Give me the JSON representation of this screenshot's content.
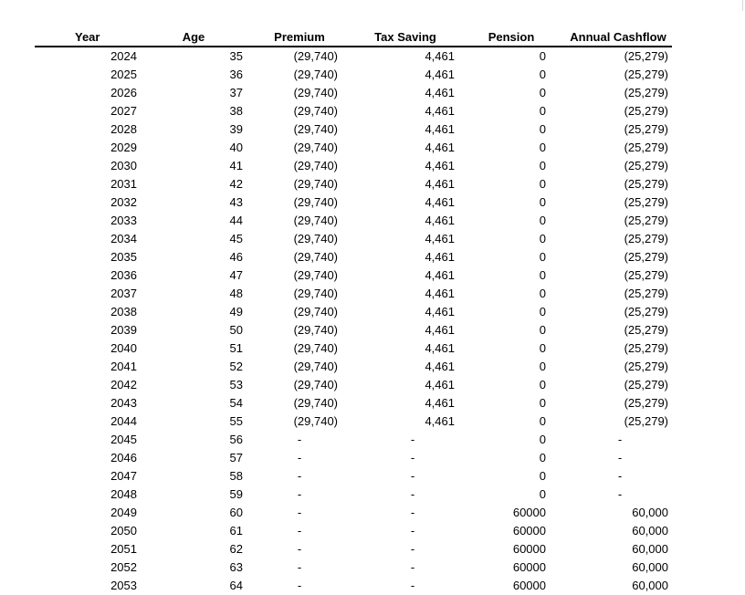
{
  "table": {
    "headers": [
      "Year",
      "Age",
      "Premium",
      "Tax Saving",
      "Pension",
      "Annual Cashflow"
    ],
    "rows": [
      [
        "2024",
        "35",
        "(29,740)",
        "4,461",
        "0",
        "(25,279)"
      ],
      [
        "2025",
        "36",
        "(29,740)",
        "4,461",
        "0",
        "(25,279)"
      ],
      [
        "2026",
        "37",
        "(29,740)",
        "4,461",
        "0",
        "(25,279)"
      ],
      [
        "2027",
        "38",
        "(29,740)",
        "4,461",
        "0",
        "(25,279)"
      ],
      [
        "2028",
        "39",
        "(29,740)",
        "4,461",
        "0",
        "(25,279)"
      ],
      [
        "2029",
        "40",
        "(29,740)",
        "4,461",
        "0",
        "(25,279)"
      ],
      [
        "2030",
        "41",
        "(29,740)",
        "4,461",
        "0",
        "(25,279)"
      ],
      [
        "2031",
        "42",
        "(29,740)",
        "4,461",
        "0",
        "(25,279)"
      ],
      [
        "2032",
        "43",
        "(29,740)",
        "4,461",
        "0",
        "(25,279)"
      ],
      [
        "2033",
        "44",
        "(29,740)",
        "4,461",
        "0",
        "(25,279)"
      ],
      [
        "2034",
        "45",
        "(29,740)",
        "4,461",
        "0",
        "(25,279)"
      ],
      [
        "2035",
        "46",
        "(29,740)",
        "4,461",
        "0",
        "(25,279)"
      ],
      [
        "2036",
        "47",
        "(29,740)",
        "4,461",
        "0",
        "(25,279)"
      ],
      [
        "2037",
        "48",
        "(29,740)",
        "4,461",
        "0",
        "(25,279)"
      ],
      [
        "2038",
        "49",
        "(29,740)",
        "4,461",
        "0",
        "(25,279)"
      ],
      [
        "2039",
        "50",
        "(29,740)",
        "4,461",
        "0",
        "(25,279)"
      ],
      [
        "2040",
        "51",
        "(29,740)",
        "4,461",
        "0",
        "(25,279)"
      ],
      [
        "2041",
        "52",
        "(29,740)",
        "4,461",
        "0",
        "(25,279)"
      ],
      [
        "2042",
        "53",
        "(29,740)",
        "4,461",
        "0",
        "(25,279)"
      ],
      [
        "2043",
        "54",
        "(29,740)",
        "4,461",
        "0",
        "(25,279)"
      ],
      [
        "2044",
        "55",
        "(29,740)",
        "4,461",
        "0",
        "(25,279)"
      ],
      [
        "2045",
        "56",
        "-",
        "-",
        "0",
        "-"
      ],
      [
        "2046",
        "57",
        "-",
        "-",
        "0",
        "-"
      ],
      [
        "2047",
        "58",
        "-",
        "-",
        "0",
        "-"
      ],
      [
        "2048",
        "59",
        "-",
        "-",
        "0",
        "-"
      ],
      [
        "2049",
        "60",
        "-",
        "-",
        "60000",
        "60,000"
      ],
      [
        "2050",
        "61",
        "-",
        "-",
        "60000",
        "60,000"
      ],
      [
        "2051",
        "62",
        "-",
        "-",
        "60000",
        "60,000"
      ],
      [
        "2052",
        "63",
        "-",
        "-",
        "60000",
        "60,000"
      ],
      [
        "2053",
        "64",
        "-",
        "-",
        "60000",
        "60,000"
      ]
    ]
  }
}
